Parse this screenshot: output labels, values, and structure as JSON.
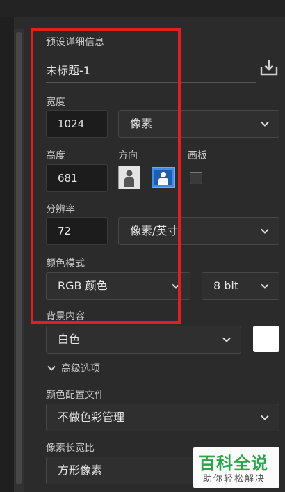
{
  "preset": {
    "section_label": "预设详细信息",
    "name": "未标题-1"
  },
  "width": {
    "label": "宽度",
    "value": "1024",
    "unit": "像素"
  },
  "height": {
    "label": "高度",
    "value": "681"
  },
  "orientation": {
    "label": "方向"
  },
  "artboard": {
    "label": "画板"
  },
  "resolution": {
    "label": "分辨率",
    "value": "72",
    "unit": "像素/英寸"
  },
  "color_mode": {
    "label": "颜色模式",
    "mode": "RGB 颜色",
    "depth": "8 bit"
  },
  "background": {
    "label": "背景内容",
    "value": "白色",
    "swatch_color": "#ffffff"
  },
  "advanced": {
    "label": "高级选项"
  },
  "color_profile": {
    "label": "颜色配置文件",
    "value": "不做色彩管理"
  },
  "pixel_aspect": {
    "label": "像素长宽比",
    "value": "方形像素"
  },
  "watermark": {
    "big": "百科全说",
    "small": "助你轻松解决"
  },
  "colors": {
    "highlight": "#e02020",
    "selected_orientation": "#3d8ee8",
    "watermark_green": "#2aa54a"
  }
}
